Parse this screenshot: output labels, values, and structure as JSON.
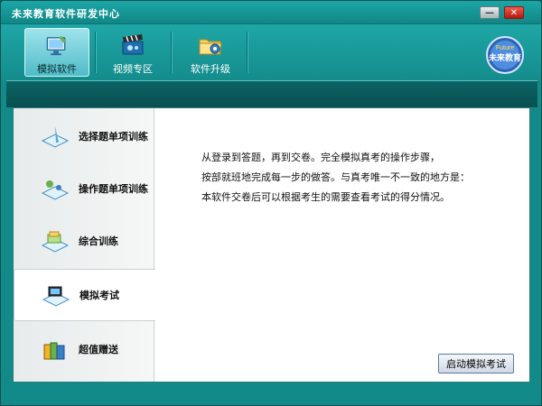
{
  "window": {
    "title": "未来教育软件研发中心",
    "minimize_symbol": "—",
    "close_symbol": "✕"
  },
  "toolbar": {
    "items": [
      {
        "label": "模拟软件",
        "icon": "monitor-icon",
        "active": true
      },
      {
        "label": "视频专区",
        "icon": "clapperboard-icon",
        "active": false
      },
      {
        "label": "软件升级",
        "icon": "folder-upgrade-icon",
        "active": false
      }
    ],
    "logo_text": "未来教育",
    "logo_subtext": "Future"
  },
  "sidebar": {
    "items": [
      {
        "label": "选择题单项训练",
        "icon": "pen-book-icon",
        "active": false
      },
      {
        "label": "操作题单项训练",
        "icon": "tools-book-icon",
        "active": false
      },
      {
        "label": "综合训练",
        "icon": "stack-book-icon",
        "active": false
      },
      {
        "label": "模拟考试",
        "icon": "laptop-book-icon",
        "active": true
      },
      {
        "label": "超值赠送",
        "icon": "books-icon",
        "active": false
      }
    ]
  },
  "main": {
    "description_lines": [
      "从登录到答题，再到交卷。完全模拟真考的操作步骤，",
      "按部就班地完成每一步的做答。与真考唯一不一致的地方是：",
      "本软件交卷后可以根据考生的需要查看考试的得分情况。"
    ],
    "start_button_label": "启动模拟考试"
  },
  "colors": {
    "frame": "#128a8a",
    "dark_bar": "#0b5b5c",
    "active_tool": "#4fbcc8"
  }
}
